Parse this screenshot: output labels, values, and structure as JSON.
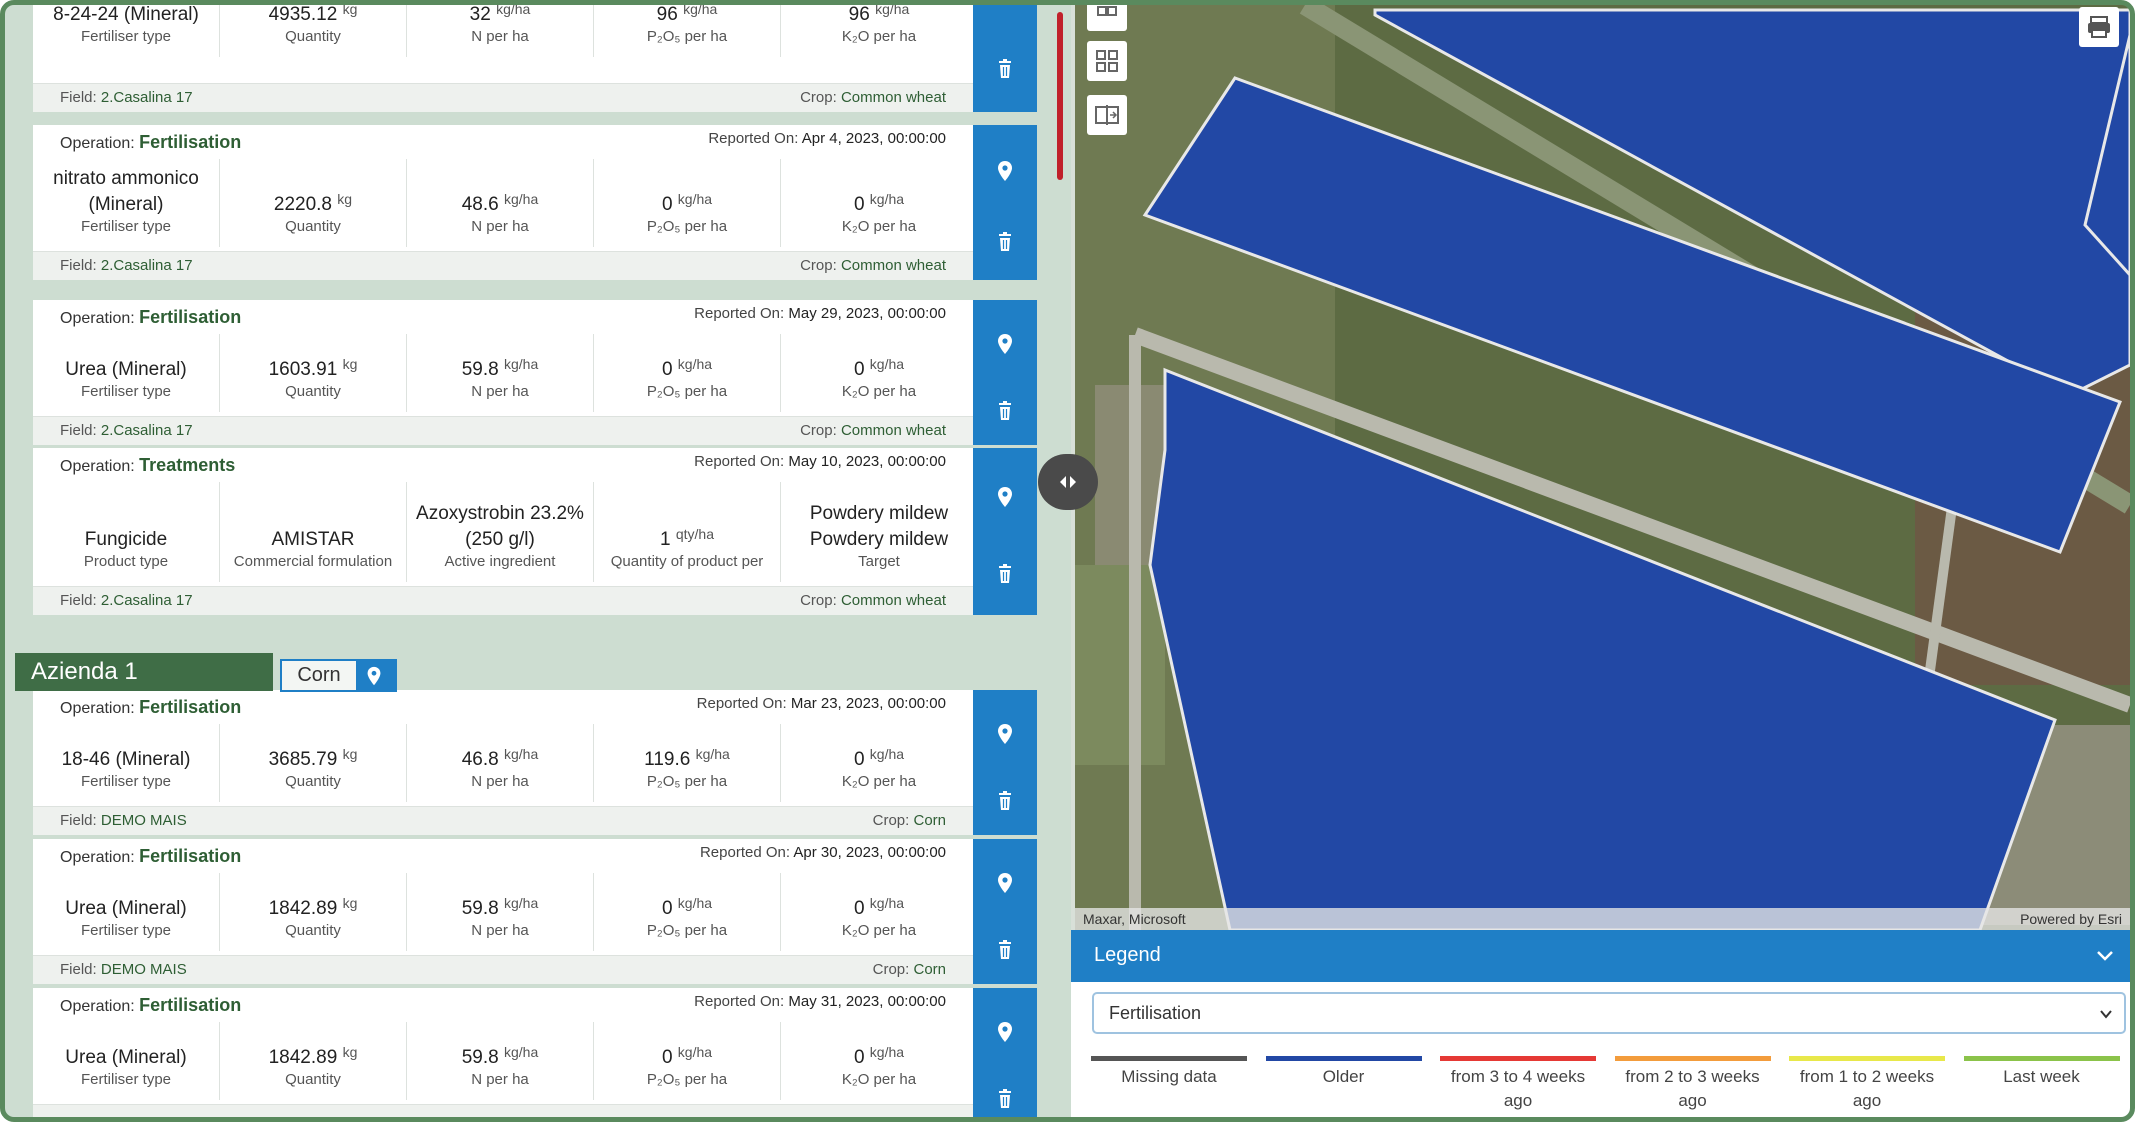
{
  "colors": {
    "accent_blue": "#1f7fc6",
    "green_dark": "#3f6d46",
    "green_text": "#2e5e34",
    "field_blue": "#2248a5"
  },
  "records": [
    {
      "op_type": "",
      "op_value": "",
      "reported_prefix": "",
      "reported_value": "",
      "cells": [
        {
          "value": "8-24-24 (Mineral)",
          "unit": "",
          "label": "Fertiliser type"
        },
        {
          "value": "4935.12",
          "unit": "kg",
          "label": "Quantity"
        },
        {
          "value": "32",
          "unit": "kg/ha",
          "label": "N per ha"
        },
        {
          "value": "96",
          "unit": "kg/ha",
          "label": "P₂O₅ per ha"
        },
        {
          "value": "96",
          "unit": "kg/ha",
          "label": "K₂O per ha"
        }
      ],
      "field_prefix": "Field:",
      "field_value": "2.Casalina 17",
      "crop_prefix": "Crop:",
      "crop_value": "Common wheat",
      "icons": [
        "trash-icon"
      ]
    },
    {
      "op_type": "Operation:",
      "op_value": "Fertilisation",
      "reported_prefix": "Reported On:",
      "reported_value": "Apr 4, 2023, 00:00:00",
      "cells": [
        {
          "value": "nitrato ammonico (Mineral)",
          "unit": "",
          "label": "Fertiliser type"
        },
        {
          "value": "2220.8",
          "unit": "kg",
          "label": "Quantity"
        },
        {
          "value": "48.6",
          "unit": "kg/ha",
          "label": "N per ha"
        },
        {
          "value": "0",
          "unit": "kg/ha",
          "label": "P₂O₅ per ha"
        },
        {
          "value": "0",
          "unit": "kg/ha",
          "label": "K₂O per ha"
        }
      ],
      "field_prefix": "Field:",
      "field_value": "2.Casalina 17",
      "crop_prefix": "Crop:",
      "crop_value": "Common wheat",
      "icons": [
        "location-pin-icon",
        "trash-icon"
      ]
    },
    {
      "op_type": "Operation:",
      "op_value": "Fertilisation",
      "reported_prefix": "Reported On:",
      "reported_value": "May 29, 2023, 00:00:00",
      "cells": [
        {
          "value": "Urea (Mineral)",
          "unit": "",
          "label": "Fertiliser type"
        },
        {
          "value": "1603.91",
          "unit": "kg",
          "label": "Quantity"
        },
        {
          "value": "59.8",
          "unit": "kg/ha",
          "label": "N per ha"
        },
        {
          "value": "0",
          "unit": "kg/ha",
          "label": "P₂O₅ per ha"
        },
        {
          "value": "0",
          "unit": "kg/ha",
          "label": "K₂O per ha"
        }
      ],
      "field_prefix": "Field:",
      "field_value": "2.Casalina 17",
      "crop_prefix": "Crop:",
      "crop_value": "Common wheat",
      "icons": [
        "location-pin-icon",
        "trash-icon"
      ]
    },
    {
      "op_type": "Operation:",
      "op_value": "Treatments",
      "reported_prefix": "Reported On:",
      "reported_value": "May 10, 2023, 00:00:00",
      "cells": [
        {
          "value": "Fungicide",
          "unit": "",
          "label": "Product type"
        },
        {
          "value": "AMISTAR",
          "unit": "",
          "label": "Commercial formulation"
        },
        {
          "value": "Azoxystrobin 23.2% (250 g/l)",
          "unit": "",
          "label": "Active ingredient"
        },
        {
          "value": "1",
          "unit": "qty/ha",
          "label": "Quantity of product per"
        },
        {
          "value": "Powdery mildew Powdery mildew",
          "unit": "",
          "label": "Target"
        }
      ],
      "field_prefix": "Field:",
      "field_value": "2.Casalina 17",
      "crop_prefix": "Crop:",
      "crop_value": "Common wheat",
      "icons": [
        "location-pin-icon",
        "trash-icon"
      ]
    },
    {
      "op_type": "Operation:",
      "op_value": "Fertilisation",
      "reported_prefix": "Reported On:",
      "reported_value": "Mar 23, 2023, 00:00:00",
      "cells": [
        {
          "value": "18-46 (Mineral)",
          "unit": "",
          "label": "Fertiliser type"
        },
        {
          "value": "3685.79",
          "unit": "kg",
          "label": "Quantity"
        },
        {
          "value": "46.8",
          "unit": "kg/ha",
          "label": "N per ha"
        },
        {
          "value": "119.6",
          "unit": "kg/ha",
          "label": "P₂O₅ per ha"
        },
        {
          "value": "0",
          "unit": "kg/ha",
          "label": "K₂O per ha"
        }
      ],
      "field_prefix": "Field:",
      "field_value": "DEMO MAIS",
      "crop_prefix": "Crop:",
      "crop_value": "Corn",
      "icons": [
        "location-pin-icon",
        "trash-icon"
      ]
    },
    {
      "op_type": "Operation:",
      "op_value": "Fertilisation",
      "reported_prefix": "Reported On:",
      "reported_value": "Apr 30, 2023, 00:00:00",
      "cells": [
        {
          "value": "Urea (Mineral)",
          "unit": "",
          "label": "Fertiliser type"
        },
        {
          "value": "1842.89",
          "unit": "kg",
          "label": "Quantity"
        },
        {
          "value": "59.8",
          "unit": "kg/ha",
          "label": "N per ha"
        },
        {
          "value": "0",
          "unit": "kg/ha",
          "label": "P₂O₅ per ha"
        },
        {
          "value": "0",
          "unit": "kg/ha",
          "label": "K₂O per ha"
        }
      ],
      "field_prefix": "Field:",
      "field_value": "DEMO MAIS",
      "crop_prefix": "Crop:",
      "crop_value": "Corn",
      "icons": [
        "location-pin-icon",
        "trash-icon"
      ]
    },
    {
      "op_type": "Operation:",
      "op_value": "Fertilisation",
      "reported_prefix": "Reported On:",
      "reported_value": "May 31, 2023, 00:00:00",
      "cells": [
        {
          "value": "Urea (Mineral)",
          "unit": "",
          "label": "Fertiliser type"
        },
        {
          "value": "1842.89",
          "unit": "kg",
          "label": "Quantity"
        },
        {
          "value": "59.8",
          "unit": "kg/ha",
          "label": "N per ha"
        },
        {
          "value": "0",
          "unit": "kg/ha",
          "label": "P₂O₅ per ha"
        },
        {
          "value": "0",
          "unit": "kg/ha",
          "label": "K₂O per ha"
        }
      ],
      "field_prefix": "",
      "field_value": "",
      "crop_prefix": "",
      "crop_value": "",
      "icons": [
        "location-pin-icon",
        "trash-icon"
      ]
    }
  ],
  "group": {
    "title": "Azienda 1",
    "crop_label": "Corn",
    "crop_icon": "location-pin-icon"
  },
  "map": {
    "attribution_left": "Maxar, Microsoft",
    "attribution_right": "Powered by Esri",
    "tool_icons": [
      "compare-icon",
      "qr-grid-icon",
      "split-view-icon",
      "print-icon"
    ],
    "split_toggle_icon": "left-right-arrows-icon"
  },
  "legend": {
    "title": "Legend",
    "select_value": "Fertilisation",
    "items": [
      {
        "label": "Missing data",
        "color": "#555555"
      },
      {
        "label": "Older",
        "color": "#2248a5"
      },
      {
        "label": "from 3 to 4 weeks ago",
        "color": "#e53935"
      },
      {
        "label": "from 2 to 3 weeks ago",
        "color": "#f39c3c"
      },
      {
        "label": "from 1 to 2 weeks ago",
        "color": "#e8e84a"
      },
      {
        "label": "Last week",
        "color": "#8bc34a"
      }
    ]
  }
}
